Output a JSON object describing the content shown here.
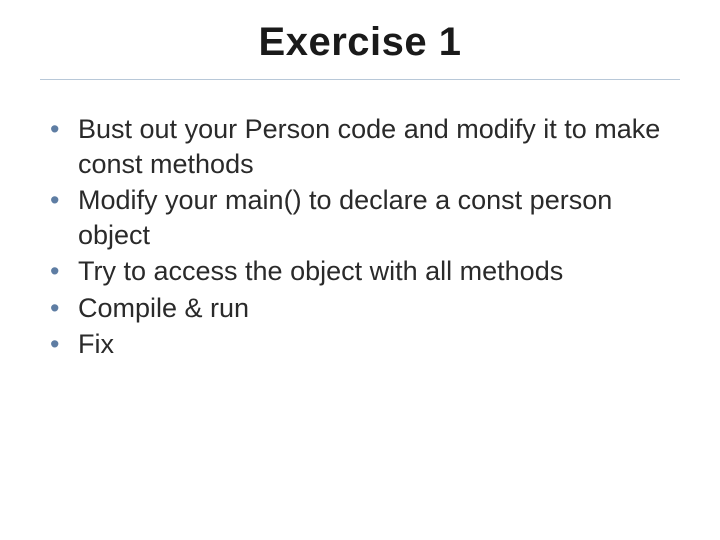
{
  "slide": {
    "title": "Exercise 1",
    "bullets": [
      "Bust out your Person code and modify it to make const methods",
      "Modify your main() to declare a const person object",
      "Try to access the object with all methods",
      "Compile & run",
      "Fix"
    ]
  }
}
